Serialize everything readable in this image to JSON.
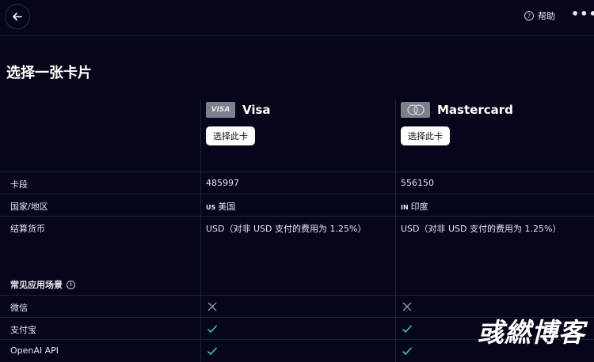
{
  "header": {
    "help_label": "帮助",
    "more_label": "•••"
  },
  "page_title": "选择一张卡片",
  "cards": [
    {
      "name": "Visa",
      "logo_text": "VISA",
      "select_label": "选择此卡",
      "bin": "485997",
      "country_code": "US",
      "country": "美国",
      "currency": "USD（对非 USD 支付的费用为 1.25%）"
    },
    {
      "name": "Mastercard",
      "logo_text": "",
      "select_label": "选择此卡",
      "bin": "556150",
      "country_code": "IN",
      "country": "印度",
      "currency": "USD（对非 USD 支付的费用为 1.25%）"
    }
  ],
  "rows": {
    "bin": "卡段",
    "country": "国家/地区",
    "currency": "结算货币"
  },
  "usage": {
    "title": "常见应用场景",
    "items": [
      {
        "label": "微信",
        "visa": "cross",
        "mastercard": "cross"
      },
      {
        "label": "支付宝",
        "visa": "check",
        "mastercard": "check"
      },
      {
        "label": "OpenAI API",
        "visa": "check",
        "mastercard": "check"
      }
    ]
  },
  "watermark": "彧繎博客",
  "colors": {
    "background": "#050619",
    "check": "#3dd68c",
    "cross": "#9a9cab",
    "button_bg": "#ffffff"
  }
}
